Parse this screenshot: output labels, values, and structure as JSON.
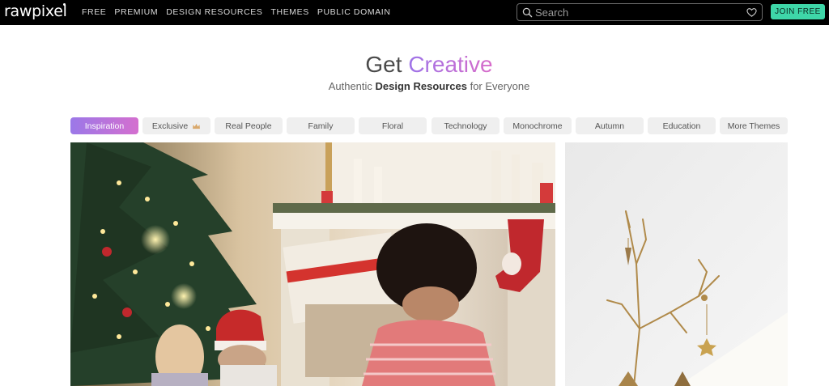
{
  "brand": {
    "logo": "rawpixel"
  },
  "nav": {
    "links": [
      "FREE",
      "PREMIUM",
      "DESIGN RESOURCES",
      "THEMES",
      "PUBLIC DOMAIN"
    ]
  },
  "search": {
    "placeholder": "Search"
  },
  "header": {
    "join_label": "JOIN FREE",
    "join_color": "#3ed6a8"
  },
  "hero": {
    "title_plain": "Get",
    "title_accent": "Creative",
    "sub_pre": "Authentic",
    "sub_bold": "Design Resources",
    "sub_post": "for Everyone"
  },
  "categories": [
    {
      "label": "Inspiration",
      "active": true
    },
    {
      "label": "Exclusive",
      "icon": "crown-icon"
    },
    {
      "label": "Real People"
    },
    {
      "label": "Family"
    },
    {
      "label": "Floral"
    },
    {
      "label": "Technology"
    },
    {
      "label": "Monochrome"
    },
    {
      "label": "Autumn"
    },
    {
      "label": "Education"
    },
    {
      "label": "More Themes"
    }
  ],
  "colors": {
    "accent_start": "#9b78e8",
    "accent_end": "#d46fcf"
  }
}
